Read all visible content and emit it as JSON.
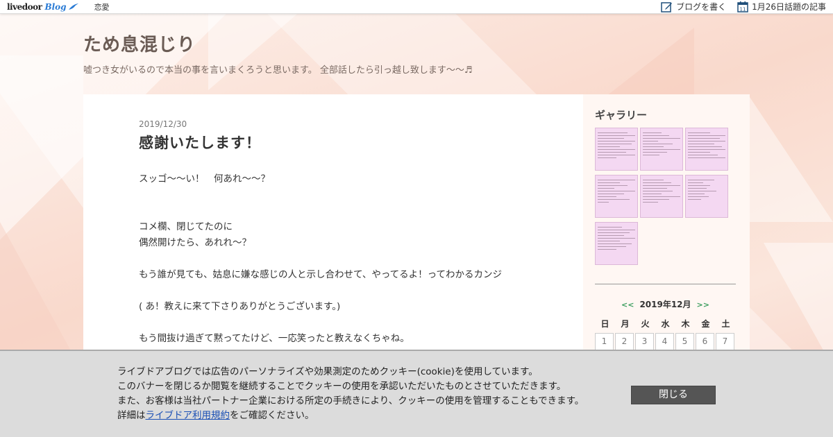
{
  "navbar": {
    "logo_text": "livedoor",
    "logo_blog": "Blog",
    "category": "恋愛",
    "write_blog": "ブログを書く",
    "calendar_day": "11",
    "topic_articles": "1月26日話題の記事"
  },
  "header": {
    "title": "ため息混じり",
    "description": "嘘つき女がいるので本当の事を言いまくろうと思います。 全部話したら引っ越し致します〜〜♬"
  },
  "post": {
    "date": "2019/12/30",
    "title": "感謝いたします！",
    "lines": [
      "スッゴ〜〜い！　何あれ〜〜？",
      "",
      "",
      "コメ欄、閉じてたのに",
      "偶然開けたら、あれれ〜？",
      "",
      "もう誰が見ても、姑息に嫌な感じの人と示し合わせて、やってるよ！ってわかるカンジ",
      "",
      "( あ！教えに来て下さりありがとうございます。)",
      "",
      "もう間抜け過ぎて黙ってたけど、一応笑ったと教えなくちゃね。"
    ]
  },
  "sidebar": {
    "gallery_title": "ギャラリー",
    "calendar": {
      "prev": "<<",
      "month": "2019年12月",
      "next": ">>",
      "weekdays": [
        "日",
        "月",
        "火",
        "水",
        "木",
        "金",
        "土"
      ],
      "first_week": [
        "1",
        "2",
        "3",
        "4",
        "5",
        "6",
        "7"
      ]
    }
  },
  "cookie_banner": {
    "line1": "ライブドアブログでは広告のパーソナライズや効果測定のためクッキー(cookie)を使用しています。",
    "line2": "このバナーを閉じるか閲覧を継続することでクッキーの使用を承認いただいたものとさせていただきます。",
    "line3": "また、お客様は当社パートナー企業における所定の手続きにより、クッキーの使用を管理することもできます。",
    "line4_prefix": "詳細は",
    "line4_link": "ライブドア利用規約",
    "line4_suffix": "をご確認ください。",
    "close_label": "閉じる"
  },
  "colors": {
    "background": "#fbe7dd",
    "title": "#6b5c55",
    "calendar_arrow": "#3a9d5d",
    "gallery_thumb": "#f4d8f2",
    "close_button": "#555555",
    "link": "#1a4fb5"
  }
}
